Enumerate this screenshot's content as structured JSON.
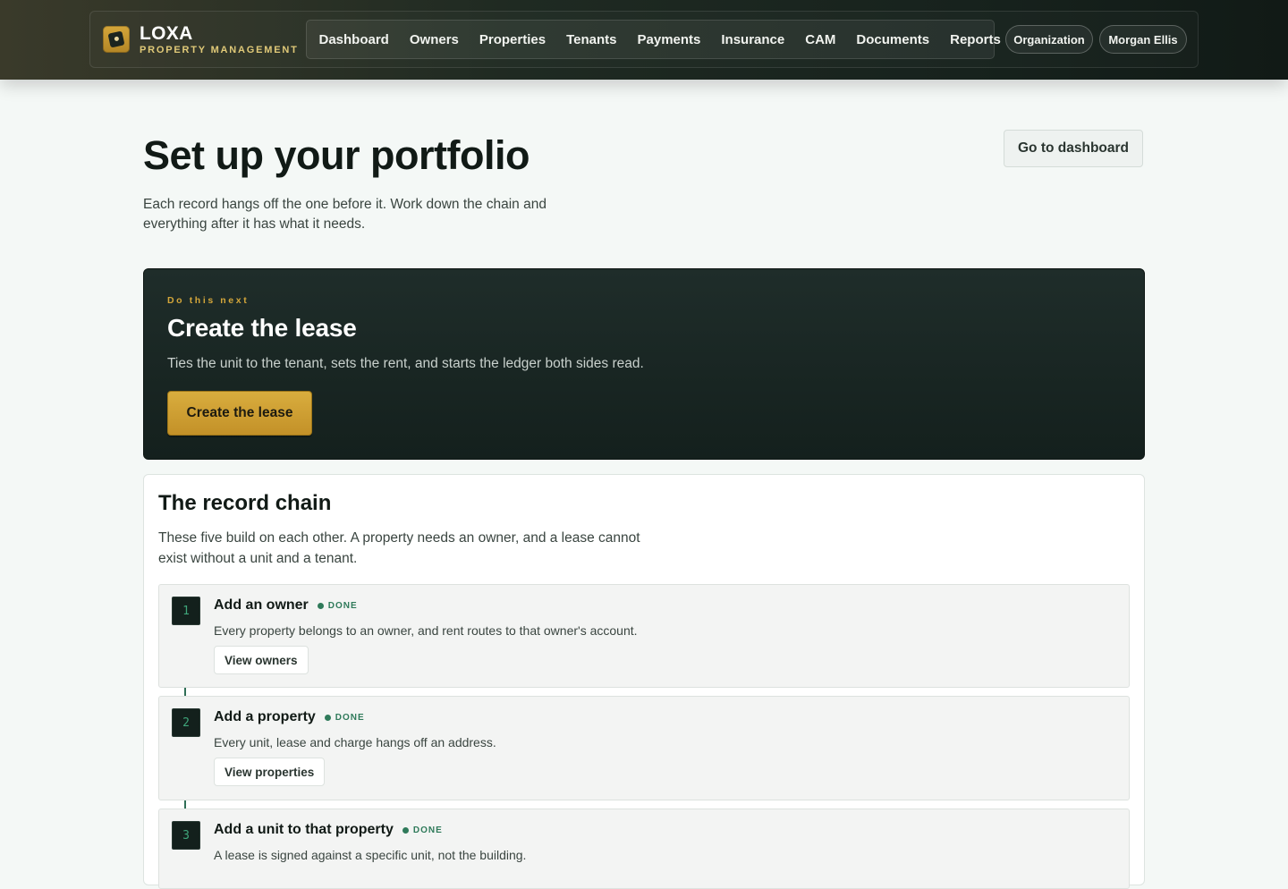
{
  "brand": {
    "name": "LOXA",
    "subtitle": "PROPERTY MANAGEMENT",
    "logo_icon": "loxa-logo-icon"
  },
  "nav": {
    "items": [
      "Dashboard",
      "Owners",
      "Properties",
      "Tenants",
      "Payments",
      "Insurance",
      "CAM",
      "Documents",
      "Reports"
    ],
    "organization_label": "Organization",
    "user_label": "Morgan Ellis"
  },
  "header": {
    "title": "Set up your portfolio",
    "intro": "Each record hangs off the one before it. Work down the chain and everything after it has what it needs.",
    "dashboard_button": "Go to dashboard"
  },
  "next_action": {
    "eyebrow": "Do this next",
    "title": "Create the lease",
    "description": "Ties the unit to the tenant, sets the rent, and starts the ledger both sides read.",
    "button": "Create the lease"
  },
  "record_chain": {
    "title": "The record chain",
    "description": "These five build on each other. A property needs an owner, and a lease cannot exist without a unit and a tenant.",
    "steps": [
      {
        "number": "1",
        "title": "Add an owner",
        "status": "DONE",
        "description": "Every property belongs to an owner, and rent routes to that owner's account.",
        "button": "View owners"
      },
      {
        "number": "2",
        "title": "Add a property",
        "status": "DONE",
        "description": "Every unit, lease and charge hangs off an address.",
        "button": "View properties"
      },
      {
        "number": "3",
        "title": "Add a unit to that property",
        "status": "DONE",
        "description": "A lease is signed against a specific unit, not the building.",
        "button": ""
      }
    ]
  },
  "colors": {
    "accent_gold": "#d4a63a",
    "done_green": "#2f7a5a",
    "hero_bg": "#1a2724"
  }
}
